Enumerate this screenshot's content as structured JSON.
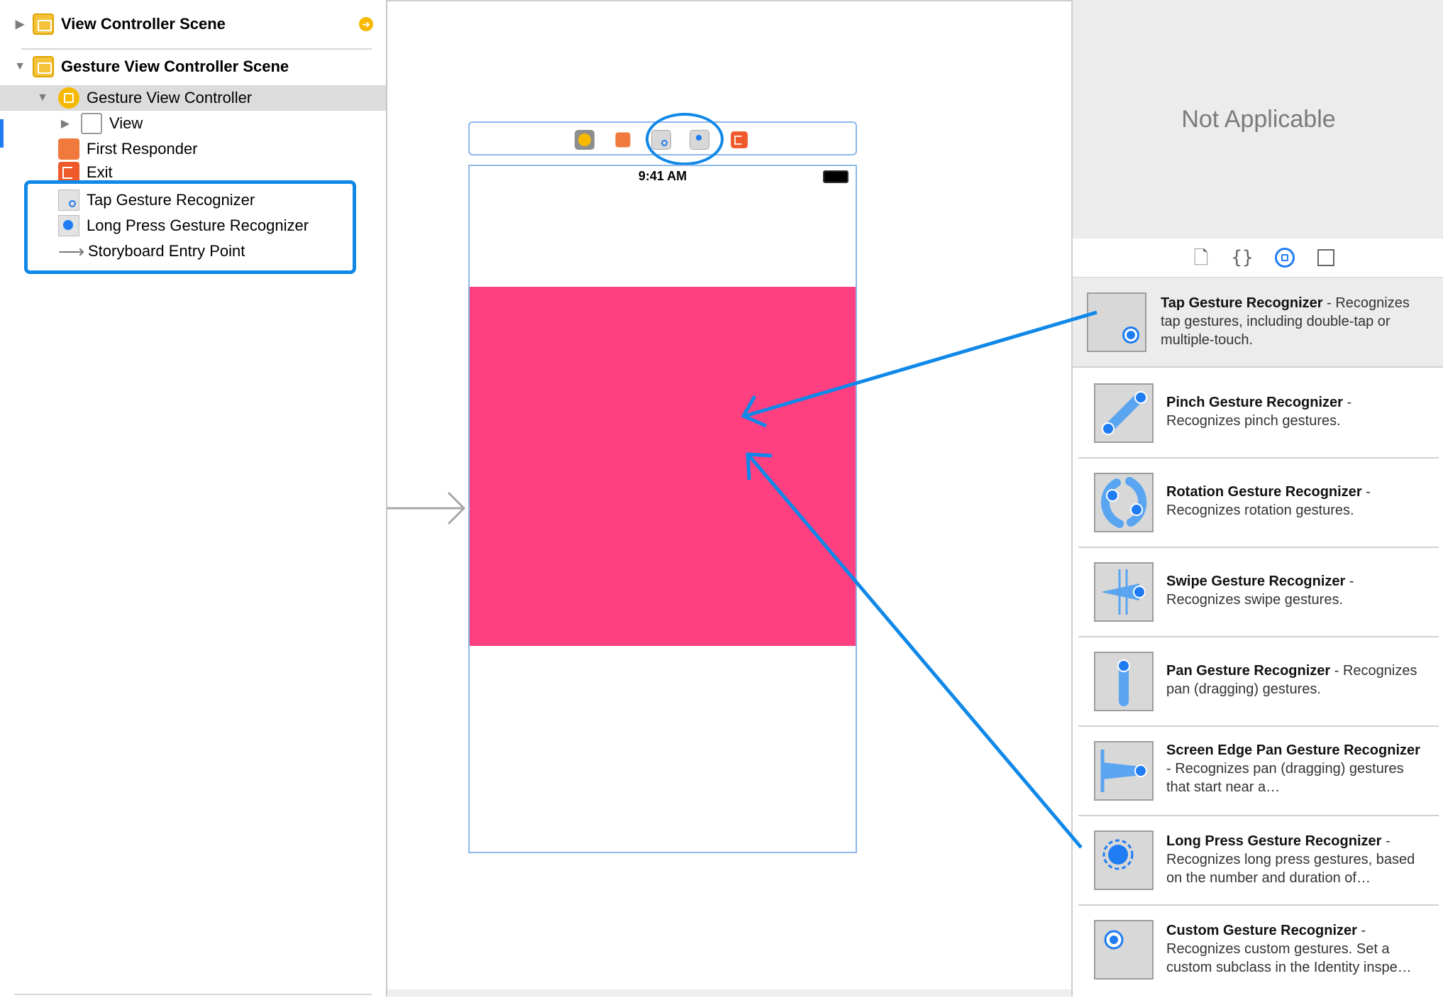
{
  "outline": {
    "rows": [
      {
        "label": "View Controller Scene"
      },
      {
        "label": "Gesture View Controller Scene"
      },
      {
        "label": "Gesture View Controller"
      },
      {
        "label": "View"
      },
      {
        "label": "First Responder"
      },
      {
        "label": "Exit"
      },
      {
        "label": "Tap Gesture Recognizer"
      },
      {
        "label": "Long Press Gesture Recognizer"
      },
      {
        "label": "Storyboard Entry Point"
      }
    ]
  },
  "canvas": {
    "status_time": "9:41 AM"
  },
  "inspector": {
    "not_applicable": "Not Applicable",
    "library": [
      {
        "title": "Tap Gesture Recognizer",
        "desc": "Recognizes tap gestures, including double-tap or multiple-touch."
      },
      {
        "title": "Pinch Gesture Recognizer",
        "desc": "Recognizes pinch gestures."
      },
      {
        "title": "Rotation Gesture Recognizer",
        "desc": "Recognizes rotation gestures."
      },
      {
        "title": "Swipe Gesture Recognizer",
        "desc": "Recognizes swipe gestures."
      },
      {
        "title": "Pan Gesture Recognizer",
        "desc": "Recognizes pan (dragging) gestures."
      },
      {
        "title": "Screen Edge Pan Gesture Recognizer",
        "desc": "Recognizes pan (dragging) gestures that start near a…"
      },
      {
        "title": "Long Press Gesture Recognizer",
        "desc": "Recognizes long press gestures, based on the number and duration of…"
      },
      {
        "title": "Custom Gesture Recognizer",
        "desc": "Recognizes custom gestures. Set a custom subclass in the Identity inspe…"
      }
    ]
  },
  "colors": {
    "accent": "#1f7cf2",
    "pink": "#fe3f80",
    "scene_yellow": "#f5c33a"
  }
}
